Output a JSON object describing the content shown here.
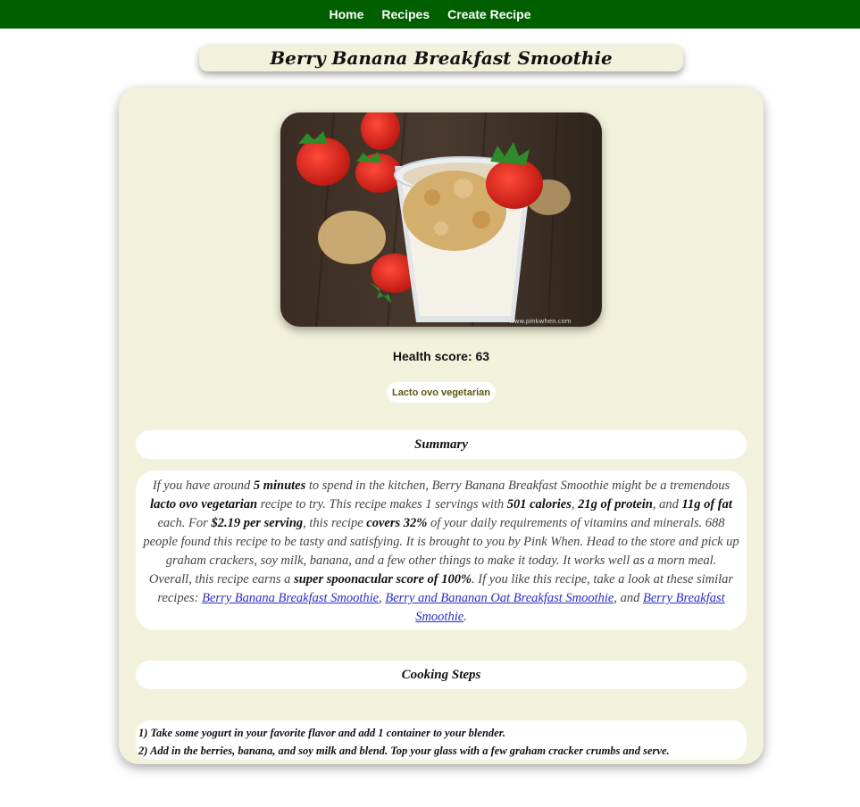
{
  "nav": {
    "items": [
      {
        "label": "Home"
      },
      {
        "label": "Recipes"
      },
      {
        "label": "Create Recipe"
      }
    ]
  },
  "recipe": {
    "title": "Berry Banana Breakfast Smoothie",
    "image_watermark": "www.pinkwhen.com",
    "health_score_label": "Health score: 63",
    "diet_badge": "Lacto ovo vegetarian"
  },
  "summary": {
    "heading": "Summary",
    "p1": "If you have around ",
    "b1": "5 minutes",
    "p2": " to spend in the kitchen, Berry Banana Breakfast Smoothie might be a tremendous ",
    "b2": "lacto ovo vegetarian",
    "p3": " recipe to try. This recipe makes 1 servings with ",
    "b3": "501 calories",
    "p4": ", ",
    "b4": "21g of protein",
    "p5": ", and ",
    "b5": "11g of fat",
    "p6": " each. For ",
    "b6": "$2.19 per serving",
    "p7": ", this recipe ",
    "b7": "covers 32%",
    "p8": " of your daily requirements of vitamins and minerals. 688 people found this recipe to be tasty and satisfying. It is brought to you by Pink When. Head to the store and pick up graham crackers, soy milk, banana, and a few other things to make it today. It works well as a morn meal. Overall, this recipe earns a ",
    "b8": "super spoonacular score of 100%",
    "p9": ". If you like this recipe, take a look at these similar recipes: ",
    "link1": "Berry Banana Breakfast Smoothie",
    "p10": ", ",
    "link2": "Berry and Bananan Oat Breakfast Smoothie",
    "p11": ", and ",
    "link3": "Berry Breakfast Smoothie",
    "p12": "."
  },
  "steps": {
    "heading": "Cooking Steps",
    "items": [
      "1) Take some yogurt in your favorite flavor and add 1 container to your blender.",
      "2) Add in the berries, banana, and soy milk and blend. Top your glass with a few graham cracker crumbs and serve."
    ]
  },
  "colors": {
    "nav_bg": "#006000",
    "card_bg": "#f2f2dc",
    "badge_text": "#5b5a14",
    "link": "#2b2bcc"
  }
}
